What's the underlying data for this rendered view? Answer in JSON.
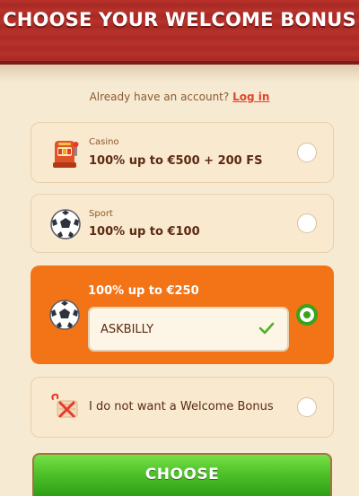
{
  "header": {
    "title": "CHOOSE YOUR WELCOME BONUS"
  },
  "login": {
    "prompt": "Already have an account?",
    "link_label": "Log in"
  },
  "options": [
    {
      "category": "Casino",
      "title": "100% up to €500 + 200 FS",
      "icon": "slot-machine-icon",
      "selected": false
    },
    {
      "category": "Sport",
      "title": "100% up to €100",
      "icon": "soccer-ball-icon",
      "selected": false
    },
    {
      "title": "100% up to €250",
      "icon": "soccer-ball-icon",
      "selected": true,
      "promo_code": "ASKBILLY"
    },
    {
      "title": "I do not want a Welcome Bonus",
      "icon": "no-bonus-icon",
      "selected": false
    }
  ],
  "choose_button": {
    "label": "CHOOSE"
  },
  "colors": {
    "header": "#b8322b",
    "accent_orange": "#f37416",
    "accent_green": "#39a319",
    "link": "#e0452b"
  }
}
